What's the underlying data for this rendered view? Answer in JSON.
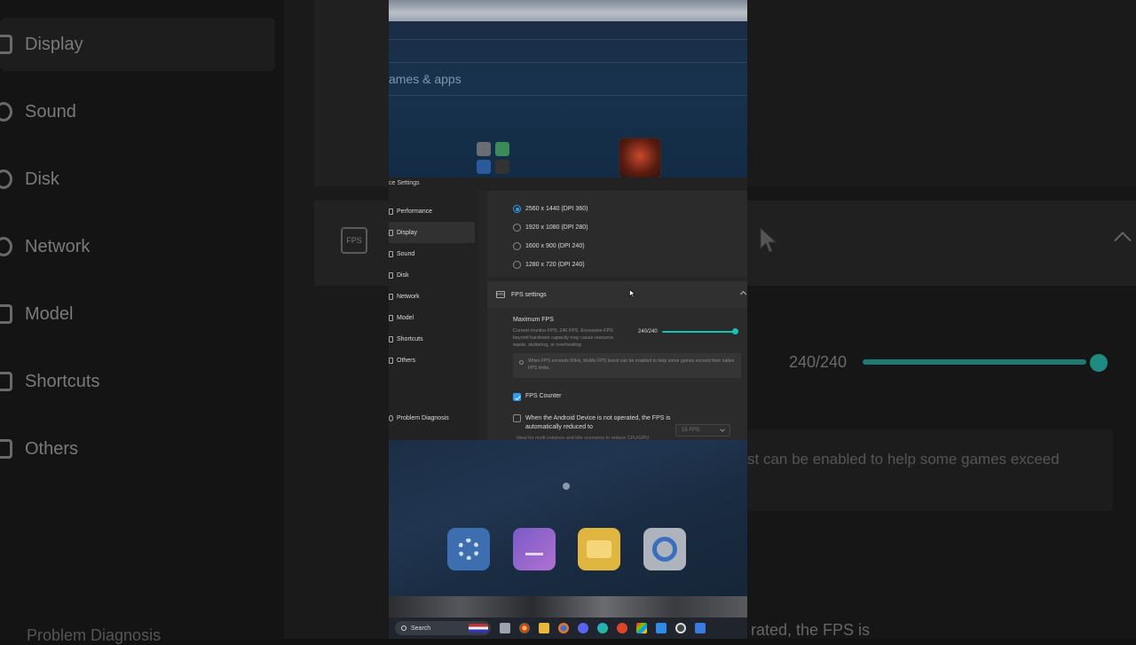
{
  "background": {
    "left_nav": [
      "Display",
      "Sound",
      "Disk",
      "Network",
      "Model",
      "Shortcuts",
      "Others"
    ],
    "bottom_left_text": "Problem Diagnosis",
    "fps_icon_label": "FPS",
    "right_fps_count": "240/240",
    "right_tip_text": "st can be enabled to help some games exceed",
    "right_bottom_text": "rated, the FPS is"
  },
  "android": {
    "apps_section_title": "ames & apps"
  },
  "settings": {
    "window_title": "ce Settings",
    "nav": [
      {
        "label": "Performance"
      },
      {
        "label": "Display"
      },
      {
        "label": "Sound"
      },
      {
        "label": "Disk"
      },
      {
        "label": "Network"
      },
      {
        "label": "Model"
      },
      {
        "label": "Shortcuts"
      },
      {
        "label": "Others"
      }
    ],
    "active_nav": "Display",
    "problem_diagnosis": "Problem Diagnosis",
    "resolutions": [
      {
        "label": "2560 x 1440 (DPI 360)",
        "selected": true
      },
      {
        "label": "1920 x 1080 (DPI 280)",
        "selected": false
      },
      {
        "label": "1600 x 900 (DPI 240)",
        "selected": false
      },
      {
        "label": "1280 x 720 (DPI 240)",
        "selected": false
      }
    ],
    "fps_section": {
      "icon_label": "FPS",
      "title": "FPS settings",
      "max_fps_label": "Maximum FPS",
      "max_fps_desc": "Current monitor FPS: 240 FPS. Excessive FPS beyond hardware capacity may cause resource waste, stuttering, or overheating",
      "max_fps_value": "240/240",
      "max_fps_fraction": 1.0,
      "tip": "When FPS exceeds 60Hz, MuMu FPS boost can be enabled to help some games exceed their native FPS limits.",
      "fps_counter_label": "FPS Counter",
      "fps_counter_checked": true,
      "auto_reduce_label": "When the Android Device is not operated, the FPS is automatically reduced to",
      "auto_reduce_checked": false,
      "auto_reduce_select": "15 FPS",
      "ideal_text": "Ideal for multi-instance and idle scenarios to reduce CPU/GPU"
    }
  },
  "taskbar": {
    "search_label": "Search"
  },
  "colors": {
    "accent_teal": "#17c3b2",
    "accent_blue": "#2e9bf0"
  }
}
